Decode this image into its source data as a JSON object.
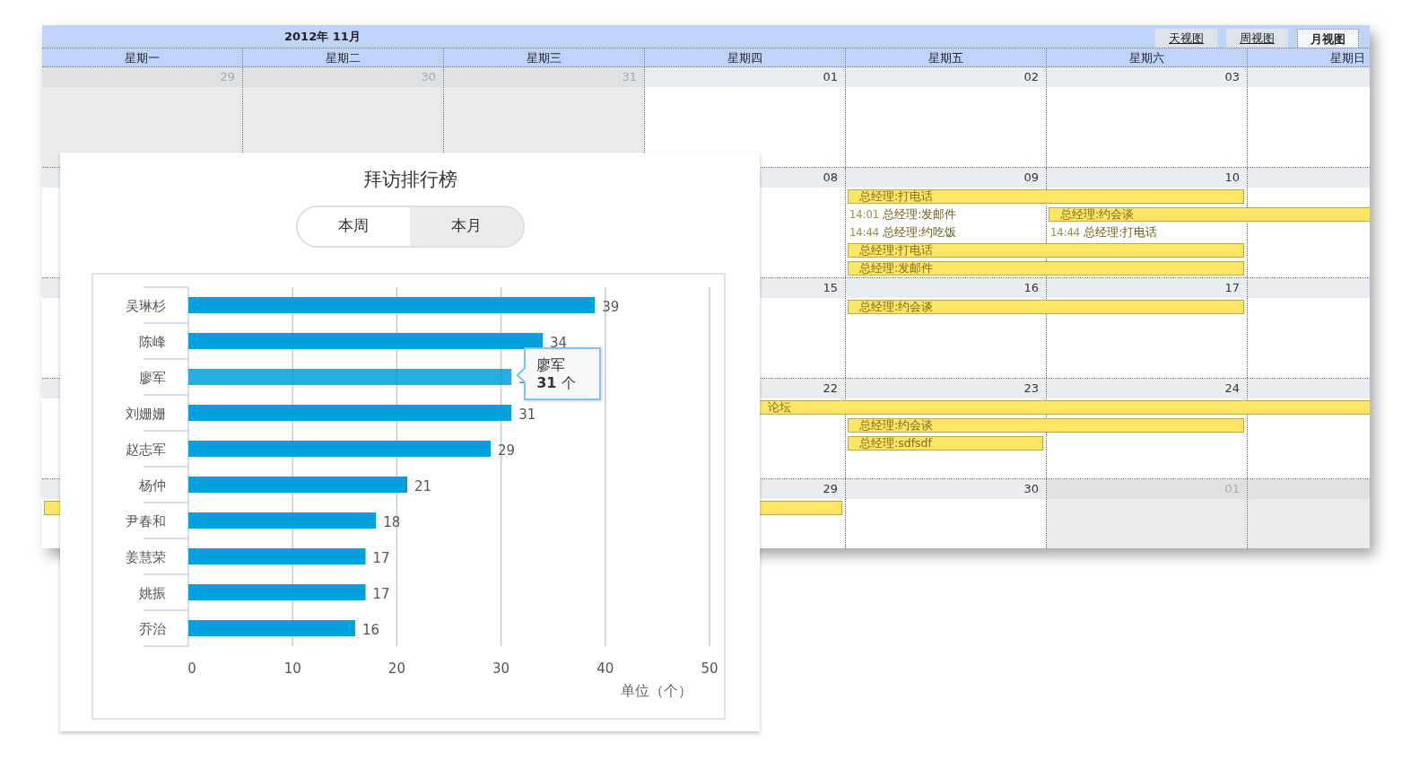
{
  "calendar": {
    "title": "2012年 11月",
    "views": [
      {
        "label": "天视图",
        "selected": false
      },
      {
        "label": "周视图",
        "selected": false
      },
      {
        "label": "月视图",
        "selected": true
      }
    ],
    "weekdays": [
      "星期一",
      "星期二",
      "星期三",
      "星期四",
      "星期五",
      "星期六",
      "星期日"
    ],
    "weeks": [
      {
        "days": [
          {
            "num": "29",
            "other_month": true
          },
          {
            "num": "30",
            "other_month": true
          },
          {
            "num": "31",
            "other_month": true
          },
          {
            "num": "01",
            "other_month": false
          },
          {
            "num": "02",
            "other_month": false
          },
          {
            "num": "03",
            "other_month": false
          },
          {
            "other_month": false
          }
        ]
      },
      {
        "monday": {
          "other_month": false
        },
        "days": [
          {
            "num": "08",
            "other_month": false
          },
          {
            "num": "09",
            "other_month": false,
            "events": [
              {
                "kind": "bar",
                "title": "总经理:打电话"
              },
              {
                "kind": "timed",
                "time": "14:01",
                "title": "总经理:发邮件"
              },
              {
                "kind": "timed",
                "time": "14:44",
                "title": "总经理:约吃饭"
              },
              {
                "kind": "bar",
                "title": "总经理:打电话"
              },
              {
                "kind": "bar",
                "title": "总经理:发邮件"
              }
            ]
          },
          {
            "num": "10",
            "other_month": false,
            "events": [
              {
                "kind": "continued"
              },
              {
                "kind": "bar",
                "title": "总经理:约会谈"
              },
              {
                "kind": "timed",
                "time": "14:44",
                "title": "总经理:打电话"
              },
              {
                "kind": "continued"
              },
              {
                "kind": "continued"
              }
            ]
          },
          {
            "other_month": false,
            "events": [
              {
                "kind": "blank"
              },
              {
                "kind": "continued"
              }
            ]
          }
        ]
      },
      {
        "monday": {
          "other_month": false
        },
        "days": [
          {
            "num": "15",
            "other_month": false
          },
          {
            "num": "16",
            "other_month": false,
            "events": [
              {
                "kind": "bar",
                "title": "总经理:约会谈"
              }
            ]
          },
          {
            "num": "17",
            "other_month": false,
            "events": [
              {
                "kind": "continued"
              }
            ]
          },
          {
            "other_month": false
          }
        ]
      },
      {
        "monday": {
          "other_month": false
        },
        "days": [
          {
            "num": "22",
            "other_month": false,
            "events": [
              {
                "kind": "bar",
                "title": "论坛",
                "cut": true
              }
            ]
          },
          {
            "num": "23",
            "other_month": false,
            "events": [
              {
                "kind": "continued"
              },
              {
                "kind": "bar",
                "title": "总经理:约会谈"
              },
              {
                "kind": "bar",
                "title": "总经理:sdfsdf"
              }
            ]
          },
          {
            "num": "24",
            "other_month": false,
            "events": [
              {
                "kind": "continued"
              },
              {
                "kind": "continued"
              }
            ]
          },
          {
            "other_month": false,
            "events": [
              {
                "kind": "continued"
              }
            ]
          }
        ]
      },
      {
        "monday": {
          "other_month": false,
          "events": [
            {
              "kind": "bar"
            }
          ]
        },
        "days": [
          {
            "num": "29",
            "other_month": false,
            "events": [
              {
                "kind": "continued"
              }
            ]
          },
          {
            "num": "30",
            "other_month": false
          },
          {
            "num": "01",
            "other_month": true
          },
          {
            "other_month": true
          }
        ]
      }
    ]
  },
  "ranking": {
    "title": "拜访排行榜",
    "toggle": [
      {
        "label": "本周",
        "selected": false
      },
      {
        "label": "本月",
        "selected": true
      }
    ],
    "chart": {
      "chart_data": {
        "type": "bar",
        "orientation": "horizontal",
        "xlabel": "单位（个）",
        "categories": [
          "吴琳杉",
          "陈峰",
          "廖军",
          "刘姗姗",
          "赵志军",
          "杨仲",
          "尹春和",
          "姜慧荣",
          "姚振",
          "乔治"
        ],
        "series": [
          {
            "color": "#00a0dc",
            "values": [
              39,
              34,
              31,
              31,
              29,
              21,
              18,
              17,
              17,
              16
            ]
          }
        ],
        "xlim": [
          0,
          50
        ],
        "xticks": [
          0,
          10,
          20,
          30,
          40,
          50
        ],
        "grid": true,
        "data_labels": true
      },
      "hovered": [
        false,
        false,
        true,
        false,
        false,
        false,
        false,
        false,
        false,
        false
      ],
      "tooltip": {
        "title": "廖军",
        "value": "31",
        "unit": "个"
      }
    }
  }
}
